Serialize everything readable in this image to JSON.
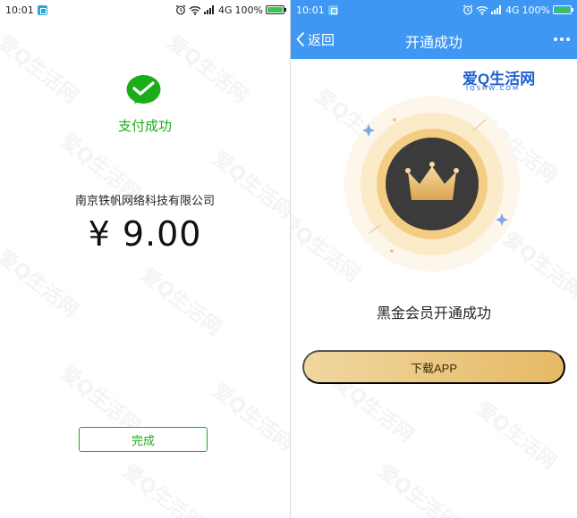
{
  "left": {
    "status_bar": {
      "time": "10:01",
      "network": "4G",
      "battery": "100%"
    },
    "pay_status": "支付成功",
    "merchant": "南京铁帆网络科技有限公司",
    "amount": "¥ 9.00",
    "done_label": "完成"
  },
  "right": {
    "status_bar": {
      "time": "10:01",
      "network": "4G",
      "battery": "100%"
    },
    "back_label": "返回",
    "title": "开通成功",
    "brand": "爱Q生活网",
    "brand_sub": "IQSHW.COM",
    "member_text": "黑金会员开通成功",
    "download_label": "下载APP"
  },
  "colors": {
    "wechat_green": "#1aad19",
    "nav_blue": "#3e97f3",
    "gold_start": "#f0d7a0",
    "gold_end": "#e6b964",
    "badge_dark": "#3b3b3b"
  }
}
